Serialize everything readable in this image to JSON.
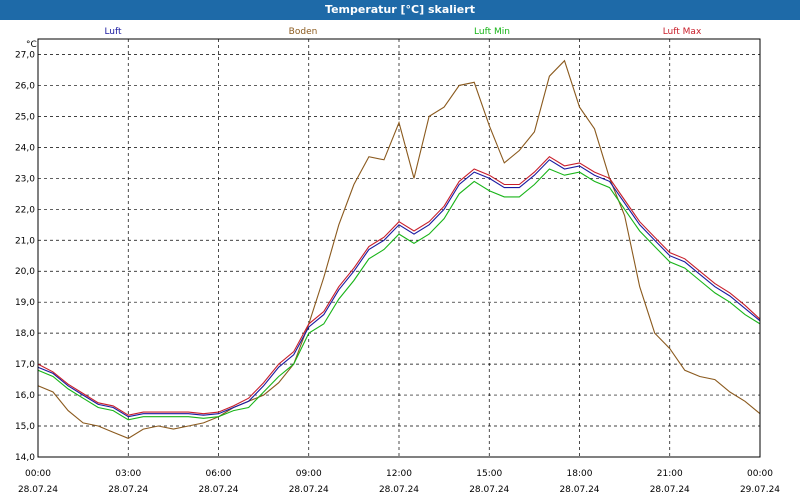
{
  "window": {
    "title": "Temperatur [°C] skaliert"
  },
  "chart_data": {
    "type": "line",
    "title": "Temperatur [°C] skaliert",
    "ylabel": "°C",
    "ylim": [
      14.0,
      27.5
    ],
    "y_ticks": [
      "14,0",
      "15,0",
      "16,0",
      "17,0",
      "18,0",
      "19,0",
      "20,0",
      "21,0",
      "22,0",
      "23,0",
      "24,0",
      "25,0",
      "26,0",
      "27,0"
    ],
    "x_ticks": [
      {
        "time": "00:00",
        "date": "28.07.24"
      },
      {
        "time": "03:00",
        "date": "28.07.24"
      },
      {
        "time": "06:00",
        "date": "28.07.24"
      },
      {
        "time": "09:00",
        "date": "28.07.24"
      },
      {
        "time": "12:00",
        "date": "28.07.24"
      },
      {
        "time": "15:00",
        "date": "28.07.24"
      },
      {
        "time": "18:00",
        "date": "28.07.24"
      },
      {
        "time": "21:00",
        "date": "28.07.24"
      },
      {
        "time": "00:00",
        "date": "29.07.24"
      }
    ],
    "grid": true,
    "legend": "top",
    "series": [
      {
        "name": "Luft",
        "color": "#1a1aa0",
        "x": [
          0,
          0.5,
          1,
          1.5,
          2,
          2.5,
          3,
          3.5,
          4,
          4.5,
          5,
          5.5,
          6,
          6.5,
          7,
          7.5,
          8,
          8.5,
          9,
          9.5,
          10,
          10.5,
          11,
          11.5,
          12,
          12.5,
          13,
          13.5,
          14,
          14.5,
          15,
          15.5,
          16,
          16.5,
          17,
          17.5,
          18,
          18.5,
          19,
          19.5,
          20,
          20.5,
          21,
          21.5,
          22,
          22.5,
          23,
          23.5,
          24
        ],
        "y": [
          16.9,
          16.7,
          16.3,
          16.0,
          15.7,
          15.6,
          15.3,
          15.4,
          15.4,
          15.4,
          15.4,
          15.35,
          15.4,
          15.6,
          15.8,
          16.3,
          16.9,
          17.3,
          18.2,
          18.6,
          19.4,
          20.0,
          20.7,
          21.0,
          21.5,
          21.2,
          21.5,
          22.0,
          22.8,
          23.2,
          23.0,
          22.7,
          22.7,
          23.1,
          23.6,
          23.3,
          23.4,
          23.1,
          22.9,
          22.2,
          21.5,
          21.0,
          20.5,
          20.3,
          19.9,
          19.5,
          19.2,
          18.8,
          18.4
        ]
      },
      {
        "name": "Boden",
        "color": "#8b5a1e",
        "x": [
          0,
          0.5,
          1,
          1.5,
          2,
          2.5,
          3,
          3.5,
          4,
          4.5,
          5,
          5.5,
          6,
          6.5,
          7,
          7.5,
          8,
          8.5,
          9,
          9.5,
          10,
          10.5,
          11,
          11.5,
          12,
          12.5,
          13,
          13.5,
          14,
          14.5,
          15,
          15.5,
          16,
          16.5,
          17,
          17.5,
          18,
          18.5,
          19,
          19.5,
          20,
          20.5,
          21,
          21.5,
          22,
          22.5,
          23,
          23.5,
          24
        ],
        "y": [
          16.3,
          16.1,
          15.5,
          15.1,
          15.0,
          14.8,
          14.6,
          14.9,
          15.0,
          14.9,
          15.0,
          15.1,
          15.3,
          15.6,
          15.8,
          16.0,
          16.4,
          17.0,
          18.3,
          19.8,
          21.5,
          22.8,
          23.7,
          23.6,
          24.8,
          23.0,
          25.0,
          25.3,
          26.0,
          26.1,
          24.7,
          23.5,
          23.9,
          24.5,
          26.3,
          26.8,
          25.3,
          24.6,
          23.0,
          21.8,
          19.5,
          18.0,
          17.5,
          16.8,
          16.6,
          16.5,
          16.1,
          15.8,
          15.4
        ]
      },
      {
        "name": "Luft Min",
        "color": "#18b418",
        "x": [
          0,
          0.5,
          1,
          1.5,
          2,
          2.5,
          3,
          3.5,
          4,
          4.5,
          5,
          5.5,
          6,
          6.5,
          7,
          7.5,
          8,
          8.5,
          9,
          9.5,
          10,
          10.5,
          11,
          11.5,
          12,
          12.5,
          13,
          13.5,
          14,
          14.5,
          15,
          15.5,
          16,
          16.5,
          17,
          17.5,
          18,
          18.5,
          19,
          19.5,
          20,
          20.5,
          21,
          21.5,
          22,
          22.5,
          23,
          23.5,
          24
        ],
        "y": [
          16.8,
          16.6,
          16.2,
          15.9,
          15.6,
          15.5,
          15.2,
          15.3,
          15.3,
          15.3,
          15.3,
          15.25,
          15.3,
          15.5,
          15.6,
          16.1,
          16.6,
          17.0,
          18.0,
          18.3,
          19.1,
          19.7,
          20.4,
          20.7,
          21.2,
          20.9,
          21.2,
          21.7,
          22.5,
          22.9,
          22.6,
          22.4,
          22.4,
          22.8,
          23.3,
          23.1,
          23.2,
          22.9,
          22.7,
          22.0,
          21.3,
          20.8,
          20.3,
          20.1,
          19.7,
          19.3,
          19.0,
          18.6,
          18.3
        ]
      },
      {
        "name": "Luft Max",
        "color": "#c81e2a",
        "x": [
          0,
          0.5,
          1,
          1.5,
          2,
          2.5,
          3,
          3.5,
          4,
          4.5,
          5,
          5.5,
          6,
          6.5,
          7,
          7.5,
          8,
          8.5,
          9,
          9.5,
          10,
          10.5,
          11,
          11.5,
          12,
          12.5,
          13,
          13.5,
          14,
          14.5,
          15,
          15.5,
          16,
          16.5,
          17,
          17.5,
          18,
          18.5,
          19,
          19.5,
          20,
          20.5,
          21,
          21.5,
          22,
          22.5,
          23,
          23.5,
          24
        ],
        "y": [
          17.0,
          16.75,
          16.35,
          16.05,
          15.75,
          15.65,
          15.35,
          15.45,
          15.45,
          15.45,
          15.45,
          15.4,
          15.45,
          15.65,
          15.9,
          16.4,
          17.0,
          17.4,
          18.3,
          18.7,
          19.5,
          20.1,
          20.8,
          21.1,
          21.6,
          21.3,
          21.6,
          22.1,
          22.9,
          23.3,
          23.1,
          22.8,
          22.8,
          23.2,
          23.7,
          23.4,
          23.5,
          23.2,
          23.0,
          22.3,
          21.6,
          21.1,
          20.6,
          20.4,
          20.0,
          19.6,
          19.3,
          18.9,
          18.45
        ]
      }
    ]
  }
}
